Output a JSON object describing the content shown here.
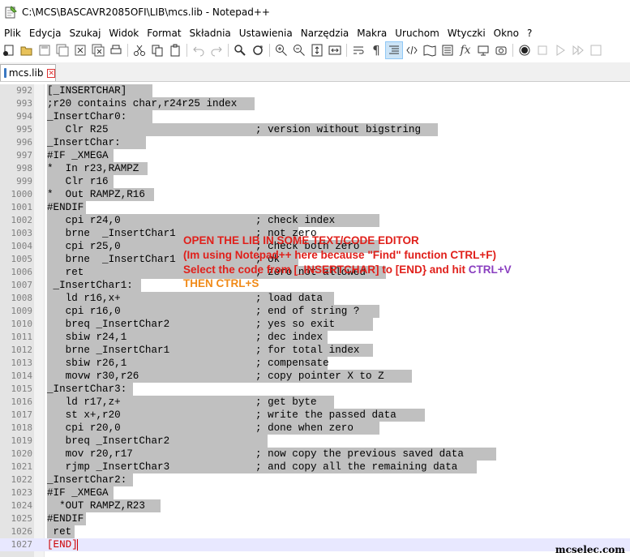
{
  "window": {
    "title": "C:\\MCS\\BASCAVR2085OFI\\LIB\\mcs.lib - Notepad++"
  },
  "menu": [
    "Plik",
    "Edycja",
    "Szukaj",
    "Widok",
    "Format",
    "Składnia",
    "Ustawienia",
    "Narzędzia",
    "Makra",
    "Uruchom",
    "Wtyczki",
    "Okno",
    "?"
  ],
  "tab": {
    "label": "mcs.lib"
  },
  "lines": [
    {
      "n": "992",
      "t": "[_INSERTCHAR]"
    },
    {
      "n": "993",
      "t": ";r20 contains char,r24r25 index"
    },
    {
      "n": "994",
      "t": "_InsertChar0:"
    },
    {
      "n": "995",
      "t": "   Clr R25                        ; version without bigstring"
    },
    {
      "n": "996",
      "t": "_InsertChar:"
    },
    {
      "n": "997",
      "t": "#IF _XMEGA"
    },
    {
      "n": "998",
      "t": "*  In r23,RAMPZ"
    },
    {
      "n": "999",
      "t": "   Clr r16"
    },
    {
      "n": "1000",
      "t": "*  Out RAMPZ,R16"
    },
    {
      "n": "1001",
      "t": "#ENDIF"
    },
    {
      "n": "1002",
      "t": "   cpi r24,0                      ; check index"
    },
    {
      "n": "1003",
      "t": "   brne  _InsertChar1             ; not zero"
    },
    {
      "n": "1004",
      "t": "   cpi r25,0                      ; check both zero"
    },
    {
      "n": "1005",
      "t": "   brne  _InsertChar1             ; ok"
    },
    {
      "n": "1006",
      "t": "   ret                            ; zero not allowed"
    },
    {
      "n": "1007",
      "t": " _InsertChar1:"
    },
    {
      "n": "1008",
      "t": "   ld r16,x+                      ; load data"
    },
    {
      "n": "1009",
      "t": "   cpi r16,0                      ; end of string ?"
    },
    {
      "n": "1010",
      "t": "   breq _InsertChar2              ; yes so exit"
    },
    {
      "n": "1011",
      "t": "   sbiw r24,1                     ; dec index"
    },
    {
      "n": "1012",
      "t": "   brne _InsertChar1              ; for total index"
    },
    {
      "n": "1013",
      "t": "   sbiw r26,1                     ; compensate"
    },
    {
      "n": "1014",
      "t": "   movw r30,r26                   ; copy pointer X to Z"
    },
    {
      "n": "1015",
      "t": "_InsertChar3:"
    },
    {
      "n": "1016",
      "t": "   ld r17,z+                      ; get byte"
    },
    {
      "n": "1017",
      "t": "   st x+,r20                      ; write the passed data"
    },
    {
      "n": "1018",
      "t": "   cpi r20,0                      ; done when zero"
    },
    {
      "n": "1019",
      "t": "   breq _InsertChar2"
    },
    {
      "n": "1020",
      "t": "   mov r20,r17                    ; now copy the previous saved data"
    },
    {
      "n": "1021",
      "t": "   rjmp _InsertChar3              ; and copy all the remaining data"
    },
    {
      "n": "1022",
      "t": "_InsertChar2:"
    },
    {
      "n": "1023",
      "t": "#IF _XMEGA"
    },
    {
      "n": "1024",
      "t": "  *OUT RAMPZ,R23"
    },
    {
      "n": "1025",
      "t": "#ENDIF"
    },
    {
      "n": "1026",
      "t": " ret"
    },
    {
      "n": "1027",
      "t": "[END]"
    }
  ],
  "annotation": {
    "line1": "OPEN THE LIB IN SOME TEXT/CODE EDITOR",
    "line2": "(Im using Notepad++ here because \"Find\" function CTRL+F)",
    "line3a": "Select the code from [_INSERTCHAR] to [END} and hit ",
    "line3b": "CTRL+V",
    "line4": "THEN CTRL+S",
    "colors": {
      "red": "#e0201b",
      "purple": "#8a3fc0",
      "orange": "#f08a18"
    }
  },
  "watermark": "mcselec.com"
}
